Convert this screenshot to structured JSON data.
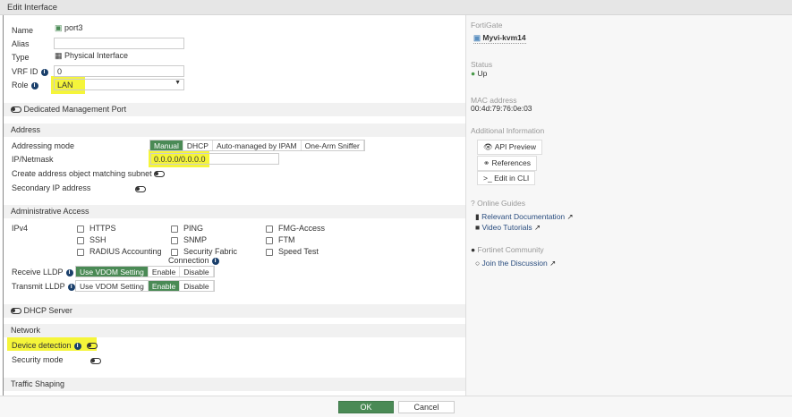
{
  "title": "Edit Interface",
  "form": {
    "name_label": "Name",
    "name_value": "port3",
    "alias_label": "Alias",
    "alias_value": "",
    "type_label": "Type",
    "type_value": "Physical Interface",
    "vrf_label": "VRF ID",
    "vrf_value": "0",
    "role_label": "Role",
    "role_value": "LAN",
    "dedicated_mgmt": "Dedicated Management Port",
    "address_section": "Address",
    "addressing_mode_label": "Addressing mode",
    "addressing_modes": [
      "Manual",
      "DHCP",
      "Auto-managed by IPAM",
      "One-Arm Sniffer"
    ],
    "ip_label": "IP/Netmask",
    "ip_value": "0.0.0.0/0.0.0.0",
    "create_addr_label": "Create address object matching subnet",
    "secondary_ip_label": "Secondary IP address",
    "admin_section": "Administrative Access",
    "ipv4_label": "IPv4",
    "access": [
      "HTTPS",
      "SSH",
      "RADIUS Accounting",
      "PING",
      "SNMP",
      "Security Fabric",
      "FMG-Access",
      "FTM",
      "Speed Test"
    ],
    "access_sf_cont": "Connection",
    "receive_lldp_label": "Receive LLDP",
    "transmit_lldp_label": "Transmit LLDP",
    "lldp_options": [
      "Use VDOM Setting",
      "Enable",
      "Disable"
    ],
    "dhcp_server": "DHCP Server",
    "network_section": "Network",
    "device_detection_label": "Device detection",
    "security_mode_label": "Security mode",
    "traffic_shaping": "Traffic Shaping"
  },
  "side": {
    "fortigate_label": "FortiGate",
    "fortigate_value": "Myvi-kvm14",
    "status_label": "Status",
    "status_value": "Up",
    "mac_label": "MAC address",
    "mac_value": "00:4d:79:76:0e:03",
    "additional_label": "Additional Information",
    "api_preview": "API Preview",
    "references": "References",
    "edit_cli": "Edit in CLI",
    "online_guides": "Online Guides",
    "relevant_docs": "Relevant Documentation",
    "video_tutorials": "Video Tutorials",
    "community": "Fortinet Community",
    "join_discussion": "Join the Discussion"
  },
  "footer": {
    "ok": "OK",
    "cancel": "Cancel"
  },
  "colors": {
    "accent": "#4a8a55",
    "highlight": "#f5f53a",
    "link": "#2a4d7f"
  }
}
